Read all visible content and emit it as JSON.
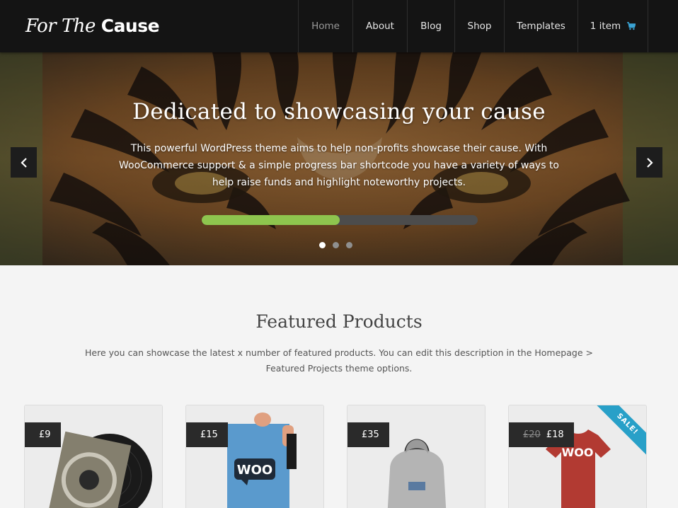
{
  "site": {
    "logo_light": "For The",
    "logo_bold": "Cause"
  },
  "nav": {
    "items": [
      {
        "label": "Home",
        "active": true
      },
      {
        "label": "About"
      },
      {
        "label": "Blog"
      },
      {
        "label": "Shop"
      },
      {
        "label": "Templates"
      }
    ],
    "cart_label": "1 item",
    "cart_icon": "shopping-cart-icon"
  },
  "hero": {
    "title": "Dedicated to showcasing your cause",
    "text": "This powerful WordPress theme aims to help non-profits showcase their cause. With WooCommerce support & a simple progress bar shortcode you have a variety of ways to help raise funds and highlight noteworthy projects.",
    "progress_fraction": 0.5,
    "slide_count": 3,
    "active_slide": 1,
    "prev_icon": "chevron-left-icon",
    "next_icon": "chevron-right-icon"
  },
  "featured": {
    "title": "Featured Products",
    "description": "Here you can showcase the latest x number of featured products. You can edit this description in the Homepage > Featured Projects theme options."
  },
  "products": [
    {
      "price": "£9",
      "image": "vinyl-record-album"
    },
    {
      "price": "£15",
      "image": "woo-poster"
    },
    {
      "price": "£35",
      "image": "grey-hoodie"
    },
    {
      "old_price": "£20",
      "price": "£18",
      "badge": "SALE!",
      "image": "red-woo-tshirt"
    }
  ],
  "colors": {
    "header_bg": "#141414",
    "progress_fill": "#8ec54e",
    "progress_track": "#4c4c4c",
    "sale_ribbon": "#28a0c8",
    "price_tag": "#2a2a2a",
    "cart_icon": "#3aa3d4"
  }
}
